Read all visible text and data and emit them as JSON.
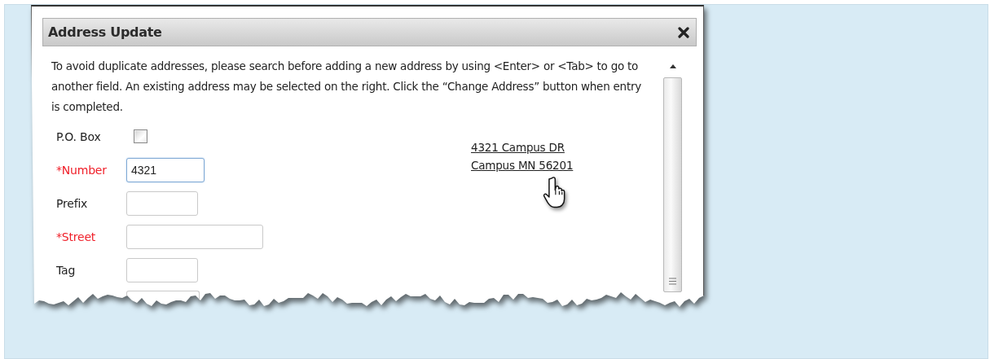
{
  "dialog": {
    "title": "Address Update",
    "instructions": "To avoid duplicate addresses, please search before adding a new address by using <Enter> or <Tab> to go to another field. An existing address may be selected on the right. Click the “Change Address” button when entry is completed.",
    "fields": [
      {
        "kind": "checkbox",
        "label": "P.O. Box",
        "required": false,
        "checked": false
      },
      {
        "kind": "text",
        "label": "*Number",
        "required": true,
        "value": "4321",
        "focused": true
      },
      {
        "kind": "text",
        "label": "Prefix",
        "required": false,
        "focused": false
      },
      {
        "kind": "text",
        "label": "*Street",
        "required": true,
        "focused": false
      },
      {
        "kind": "text",
        "label": "Tag",
        "required": false,
        "focused": false
      },
      {
        "kind": "partial"
      }
    ],
    "matches": [
      {
        "lines": [
          "4321 Campus DR",
          "Campus MN 56201"
        ]
      }
    ]
  }
}
